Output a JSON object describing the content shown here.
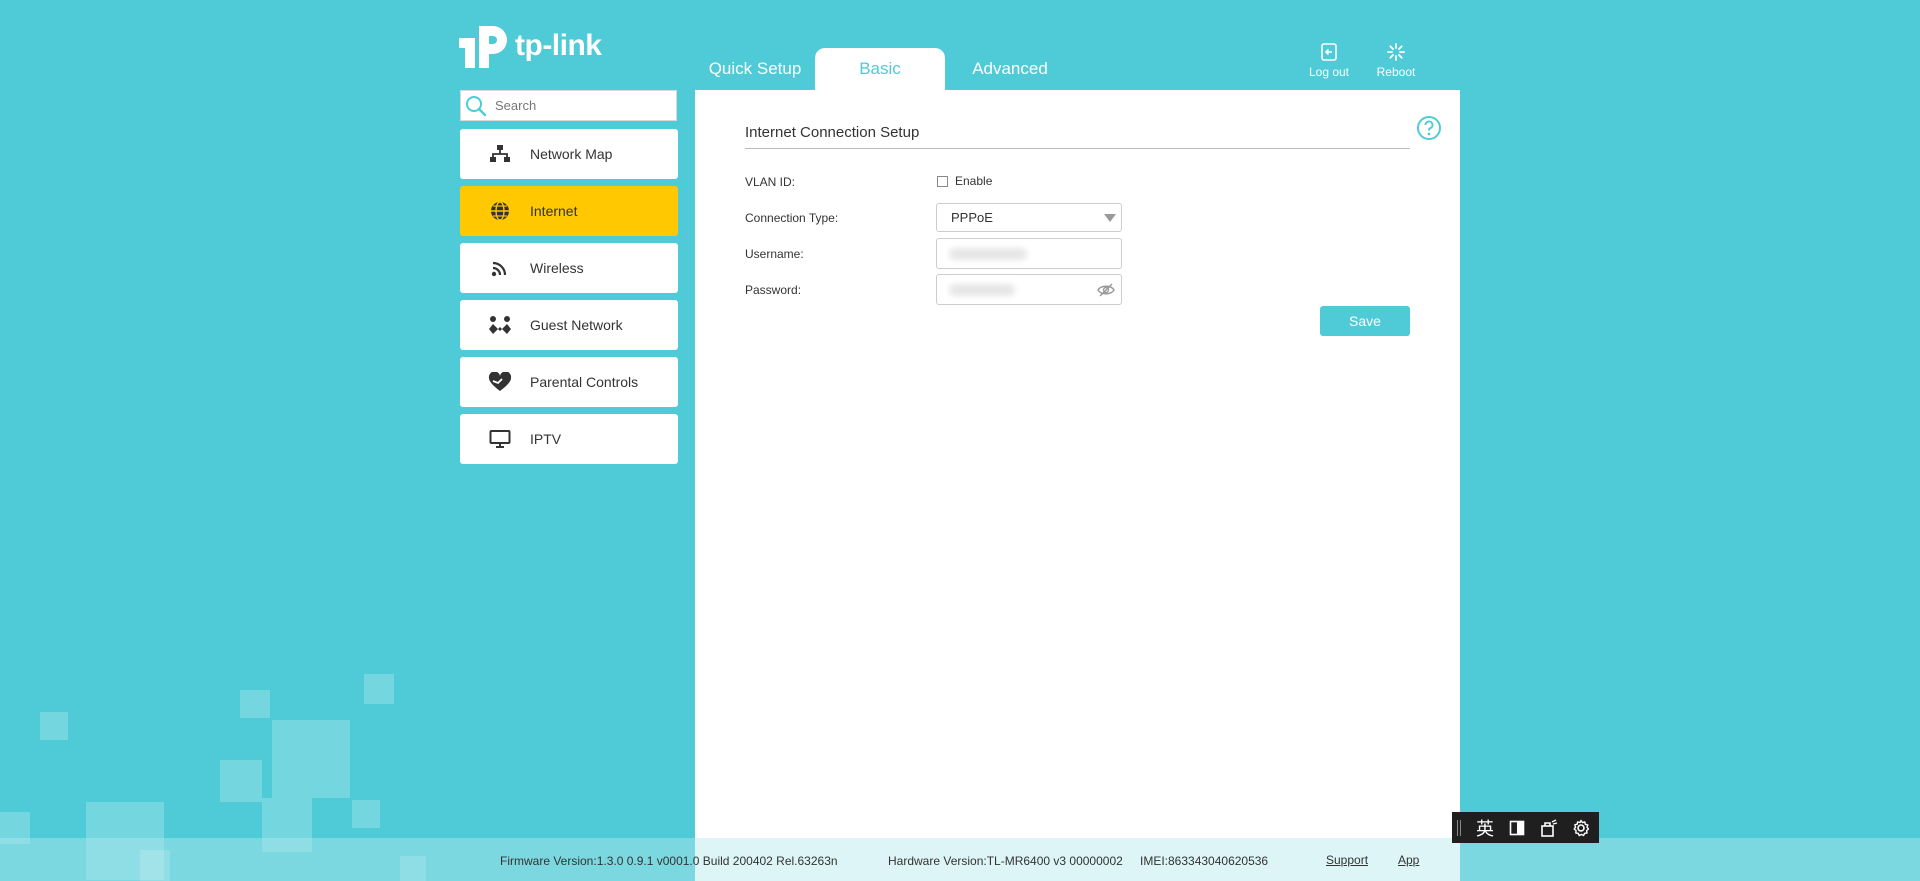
{
  "brand": {
    "logo_text": "tp-link"
  },
  "tabs": {
    "quick_setup": "Quick Setup",
    "basic": "Basic",
    "advanced": "Advanced"
  },
  "topbar": {
    "logout": "Log out",
    "reboot": "Reboot"
  },
  "sidebar": {
    "search_placeholder": "Search",
    "items": [
      {
        "label": "Network Map",
        "icon": "network-map-icon"
      },
      {
        "label": "Internet",
        "icon": "globe-icon",
        "active": true
      },
      {
        "label": "Wireless",
        "icon": "wireless-icon"
      },
      {
        "label": "Guest Network",
        "icon": "guest-network-icon"
      },
      {
        "label": "Parental Controls",
        "icon": "heart-icon"
      },
      {
        "label": "IPTV",
        "icon": "monitor-icon"
      }
    ]
  },
  "main": {
    "section_title": "Internet Connection Setup",
    "vlan_label": "VLAN ID:",
    "vlan_enable_label": "Enable",
    "vlan_enabled": false,
    "connection_type_label": "Connection Type:",
    "connection_type_value": "PPPoE",
    "username_label": "Username:",
    "password_label": "Password:",
    "save_label": "Save"
  },
  "footer": {
    "firmware": "Firmware Version:1.3.0 0.9.1 v0001.0 Build 200402 Rel.63263n",
    "hardware": "Hardware Version:TL-MR6400 v3 00000002",
    "imei": "IMEI:863343040620536",
    "support": "Support",
    "app": "App"
  },
  "ime_toolbar": {
    "lang": "英"
  },
  "colors": {
    "accent": "#4ecbd6",
    "active_menu": "#ffc800",
    "panel": "#ffffff"
  }
}
